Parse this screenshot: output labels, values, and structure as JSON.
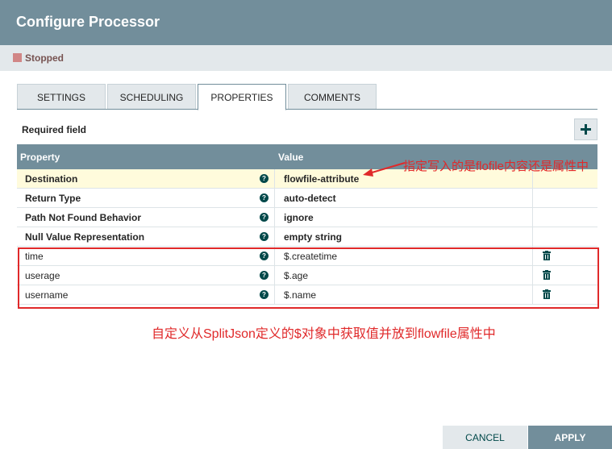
{
  "dialog": {
    "title": "Configure Processor",
    "status": "Stopped",
    "colors": {
      "header": "#728e9b",
      "stopped": "#d18686",
      "annotation": "#e0292a"
    }
  },
  "tabs": [
    {
      "label": "SETTINGS",
      "active": false
    },
    {
      "label": "SCHEDULING",
      "active": false
    },
    {
      "label": "PROPERTIES",
      "active": true
    },
    {
      "label": "COMMENTS",
      "active": false
    }
  ],
  "properties": {
    "required_label": "Required field",
    "add_icon": "plus-icon",
    "columns": {
      "property": "Property",
      "value": "Value"
    },
    "rows": [
      {
        "name": "Destination",
        "value": "flowfile-attribute",
        "required": true,
        "selected": true
      },
      {
        "name": "Return Type",
        "value": "auto-detect",
        "required": true
      },
      {
        "name": "Path Not Found Behavior",
        "value": "ignore",
        "required": true
      },
      {
        "name": "Null Value Representation",
        "value": "empty string",
        "required": true
      },
      {
        "name": "time",
        "value": "$.createtime",
        "required": false,
        "deletable": true
      },
      {
        "name": "userage",
        "value": "$.age",
        "required": false,
        "deletable": true
      },
      {
        "name": "username",
        "value": "$.name",
        "required": false,
        "deletable": true
      }
    ]
  },
  "annotations": {
    "destination_note": "指定写入的是flofile内容还是属性中",
    "custom_note": "自定义从SplitJson定义的$对象中获取值并放到flowfile属性中"
  },
  "footer": {
    "cancel_label": "CANCEL",
    "apply_label": "APPLY"
  }
}
